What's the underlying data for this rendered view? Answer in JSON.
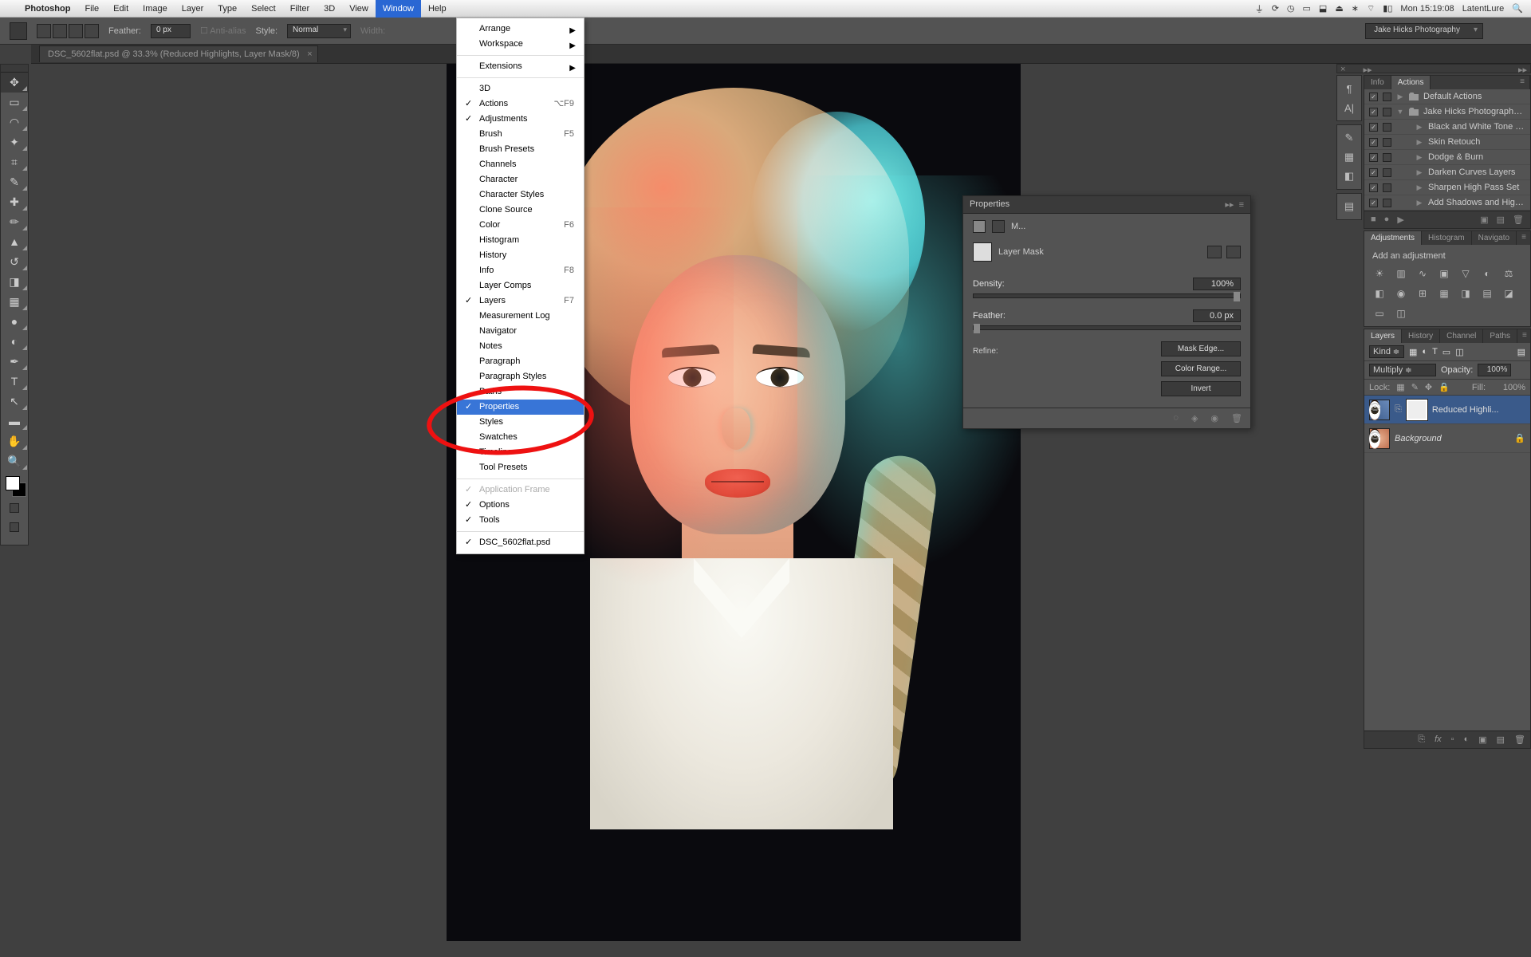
{
  "menubar": {
    "app": "Photoshop",
    "items": [
      "File",
      "Edit",
      "Image",
      "Layer",
      "Type",
      "Select",
      "Filter",
      "3D",
      "View",
      "Window",
      "Help"
    ],
    "right_time": "Mon 15:19:08",
    "right_user": "LatentLure"
  },
  "dropdown": {
    "arrange": "Arrange",
    "workspace": "Workspace",
    "extensions": "Extensions",
    "threeD": "3D",
    "actions": "Actions",
    "actions_sc": "⌥F9",
    "adjustments": "Adjustments",
    "brush": "Brush",
    "brush_sc": "F5",
    "brush_presets": "Brush Presets",
    "channels": "Channels",
    "character": "Character",
    "character_styles": "Character Styles",
    "clone_source": "Clone Source",
    "color": "Color",
    "color_sc": "F6",
    "histogram": "Histogram",
    "history": "History",
    "info": "Info",
    "info_sc": "F8",
    "layer_comps": "Layer Comps",
    "layers": "Layers",
    "layers_sc": "F7",
    "measurement": "Measurement Log",
    "navigator": "Navigator",
    "notes": "Notes",
    "paragraph": "Paragraph",
    "paragraph_styles": "Paragraph Styles",
    "paths": "Paths",
    "properties": "Properties",
    "styles": "Styles",
    "swatches": "Swatches",
    "timeline": "Timeline",
    "tool_presets": "Tool Presets",
    "app_frame": "Application Frame",
    "options": "Options",
    "tools": "Tools",
    "file": "DSC_5602flat.psd"
  },
  "optionsbar": {
    "feather_lbl": "Feather:",
    "feather_val": "0 px",
    "antialias": "Anti-alias",
    "style_lbl": "Style:",
    "style_val": "Normal",
    "width_lbl": "Width:",
    "docname": "Jake Hicks Photography"
  },
  "tab": {
    "label": "DSC_5602flat.psd @ 33.3% (Reduced Highlights, Layer Mask/8)",
    "x": "×"
  },
  "props": {
    "title": "Properties",
    "sub": "M...",
    "layer_mask": "Layer Mask",
    "density_lbl": "Density:",
    "density_val": "100%",
    "feather_lbl": "Feather:",
    "feather_val": "0.0 px",
    "refine_lbl": "Refine:",
    "btn_mask": "Mask Edge...",
    "btn_color": "Color Range...",
    "btn_invert": "Invert"
  },
  "actions": {
    "tab_info": "Info",
    "tab_actions": "Actions",
    "set_default": "Default Actions",
    "set_jake": "Jake Hicks Photography ...",
    "a1": "Black and White Tone Pr...",
    "a2": "Skin Retouch",
    "a3": "Dodge & Burn",
    "a4": "Darken Curves Layers",
    "a5": "Sharpen High Pass Set",
    "a6": "Add Shadows and Highli..."
  },
  "adjust": {
    "tab_adj": "Adjustments",
    "tab_hist": "Histogram",
    "tab_nav": "Navigato",
    "title": "Add an adjustment"
  },
  "layers": {
    "tab_layers": "Layers",
    "tab_history": "History",
    "tab_channels": "Channel",
    "tab_paths": "Paths",
    "kind_lbl": "Kind",
    "blend": "Multiply",
    "opacity_lbl": "Opacity:",
    "opacity_val": "100%",
    "lock_lbl": "Lock:",
    "fill_lbl": "Fill:",
    "fill_val": "100%",
    "layer1": "Reduced Highli...",
    "layer2": "Background"
  }
}
